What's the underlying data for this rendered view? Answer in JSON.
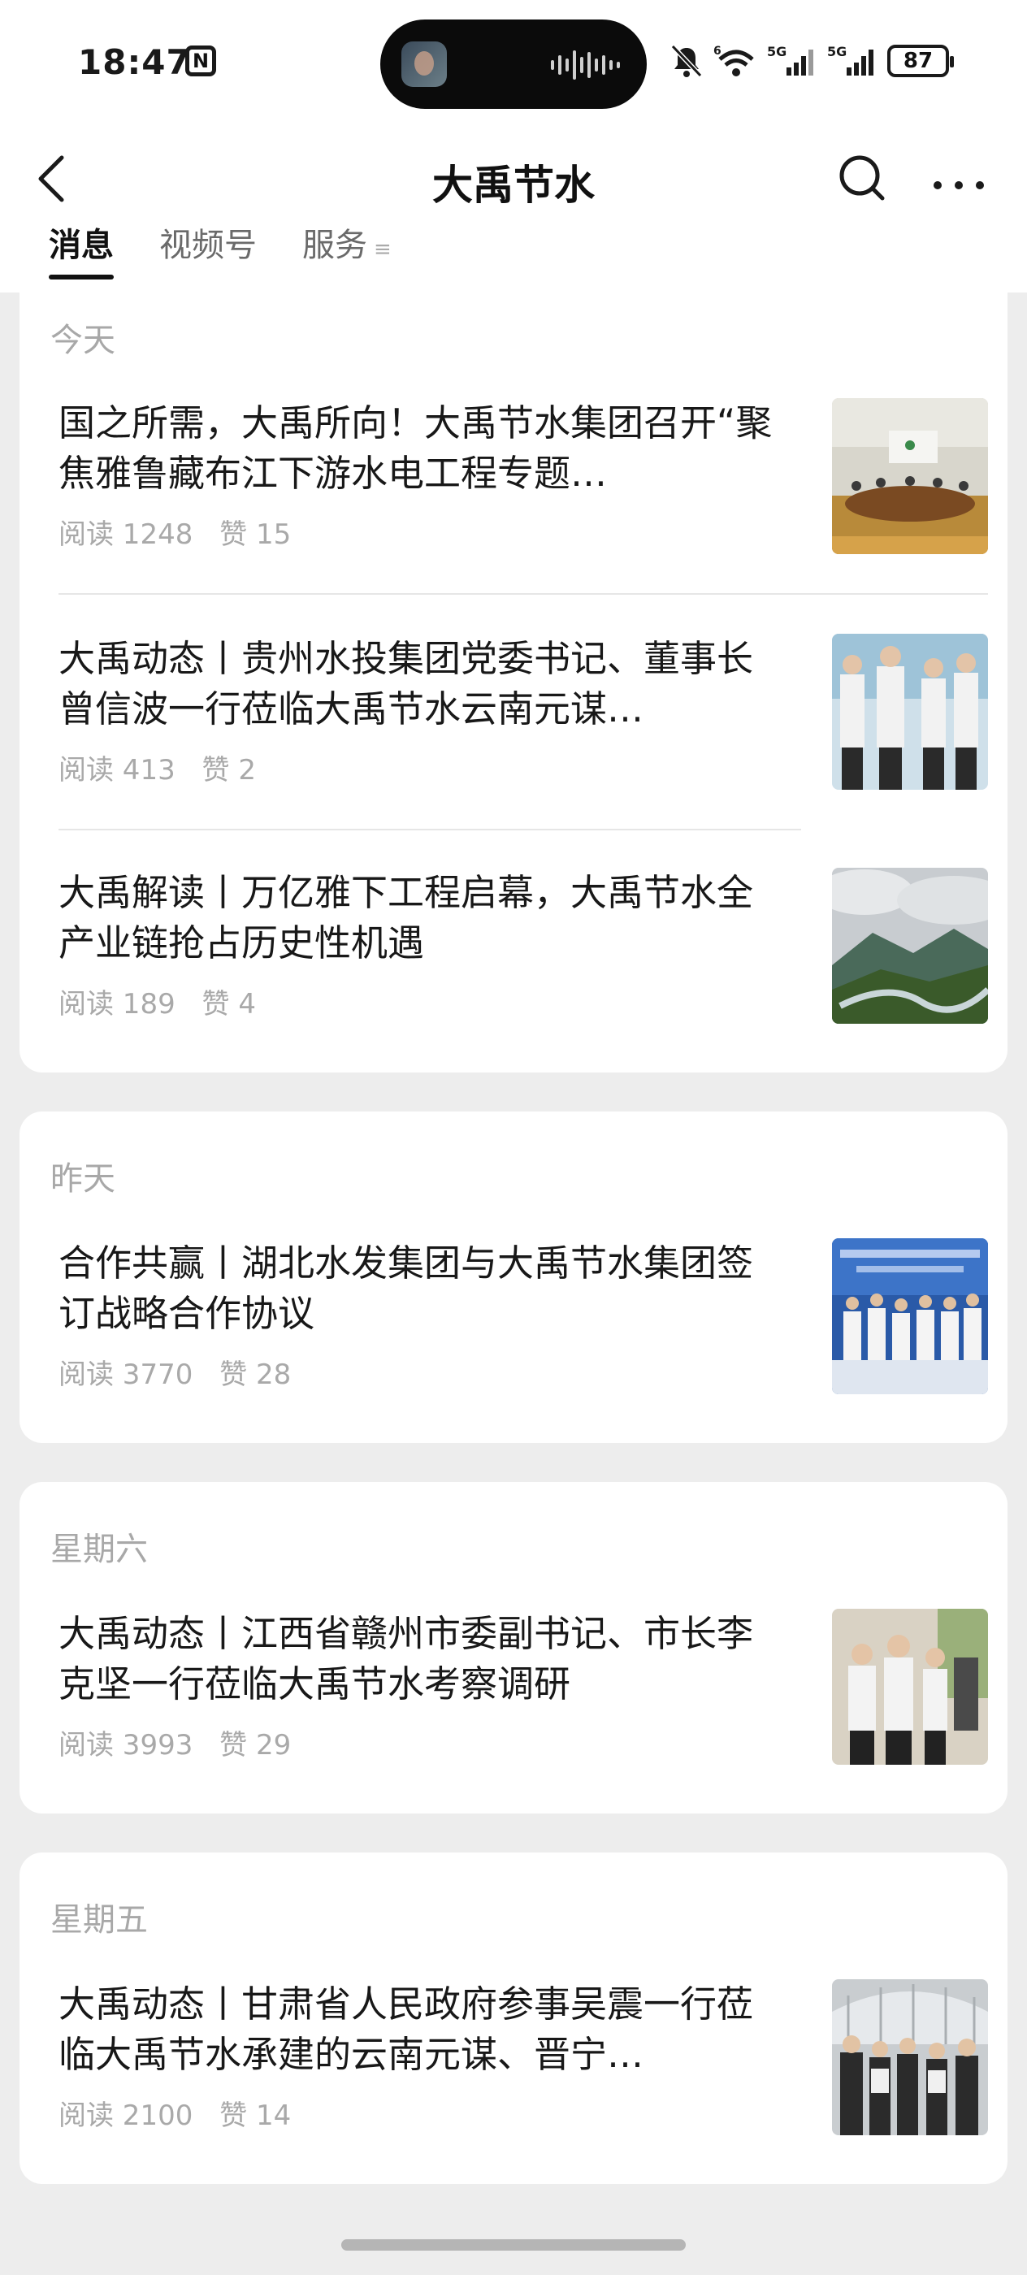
{
  "status_bar": {
    "time": "18:47",
    "battery": "87",
    "signal_1_label": "5G",
    "signal_2_label": "5G",
    "wifi_label": "6"
  },
  "header": {
    "title": "大禹节水",
    "tabs": [
      "消息",
      "视频号",
      "服务"
    ],
    "active_tab": "消息"
  },
  "feed": {
    "groups": [
      {
        "day": "今天",
        "articles": [
          {
            "title": "国之所需，大禹所向！大禹节水集团召开“聚焦雅鲁藏布江下游水电工程专题…",
            "stats": "阅读 1248 赞 15",
            "read": "阅读 1248",
            "like": "赞 15",
            "thumb_icon": "meeting-room-photo"
          },
          {
            "title": "大禹动态丨贵州水投集团党委书记、董事长曾信波一行莅临大禹节水云南元谋…",
            "read": "阅读 413",
            "like": "赞 2",
            "thumb_icon": "group-visit-photo"
          },
          {
            "title": "大禹解读丨万亿雅下工程启幕，大禹节水全产业链抢占历史性机遇",
            "read": "阅读 189",
            "like": "赞 4",
            "thumb_icon": "river-valley-photo"
          }
        ]
      },
      {
        "day": "昨天",
        "articles": [
          {
            "title": "合作共赢丨湖北水发集团与大禹节水集团签订战略合作协议",
            "read": "阅读 3770",
            "like": "赞 28",
            "thumb_icon": "signing-ceremony-photo"
          }
        ]
      },
      {
        "day": "星期六",
        "articles": [
          {
            "title": "大禹动态丨江西省赣州市委副书记、市长李克坚一行莅临大禹节水考察调研",
            "read": "阅读 3993",
            "like": "赞 29",
            "thumb_icon": "inspection-photo"
          }
        ]
      },
      {
        "day": "星期五",
        "articles": [
          {
            "title": "大禹动态丨甘肃省人民政府参事吴震一行莅临大禹节水承建的云南元谋、晋宁…",
            "read": "阅读 2100",
            "like": "赞 14",
            "thumb_icon": "warehouse-visit-photo"
          }
        ]
      }
    ]
  },
  "colors": {
    "background": "#ededed",
    "card": "#ffffff",
    "muted_text": "#a9a9a9"
  }
}
